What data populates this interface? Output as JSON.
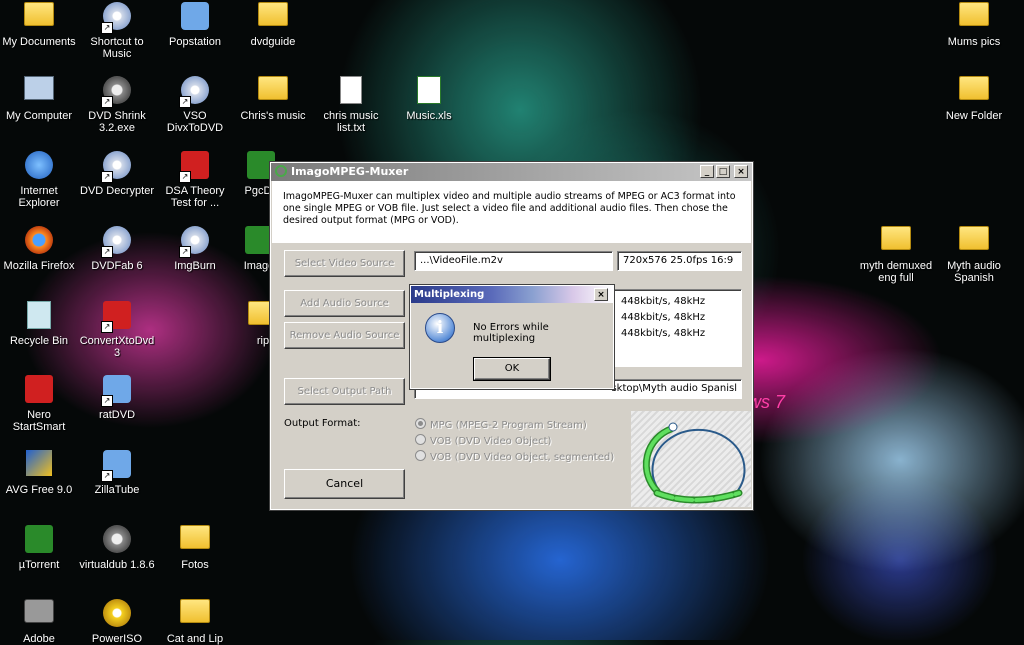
{
  "desktop": {
    "icons": [
      {
        "id": "my-documents",
        "label": "My Documents",
        "glyph": "g-folder",
        "shortcut": false
      },
      {
        "id": "shortcut-music",
        "label": "Shortcut to Music",
        "glyph": "g-disc",
        "shortcut": true
      },
      {
        "id": "popstation",
        "label": "Popstation",
        "glyph": "g-generic",
        "shortcut": false
      },
      {
        "id": "dvdguide",
        "label": "dvdguide",
        "glyph": "g-folder",
        "shortcut": false
      },
      {
        "id": "mums-pics",
        "label": "Mums pics",
        "glyph": "g-folder",
        "shortcut": false
      },
      {
        "id": "my-computer",
        "label": "My Computer",
        "glyph": "g-pc",
        "shortcut": false
      },
      {
        "id": "dvd-shrink",
        "label": "DVD Shrink 3.2.exe",
        "glyph": "g-gear",
        "shortcut": true
      },
      {
        "id": "vso-divx",
        "label": "VSO DivxToDVD",
        "glyph": "g-disc",
        "shortcut": true
      },
      {
        "id": "chris-music",
        "label": "Chris's music",
        "glyph": "g-folder",
        "shortcut": false
      },
      {
        "id": "chris-music-list",
        "label": "chris music list.txt",
        "glyph": "g-doc",
        "shortcut": false
      },
      {
        "id": "music-xls",
        "label": "Music.xls",
        "glyph": "g-xls",
        "shortcut": false
      },
      {
        "id": "new-folder",
        "label": "New Folder",
        "glyph": "g-folder",
        "shortcut": false
      },
      {
        "id": "internet-explorer",
        "label": "Internet Explorer",
        "glyph": "g-ie",
        "shortcut": false
      },
      {
        "id": "dvd-decrypter",
        "label": "DVD Decrypter",
        "glyph": "g-disc",
        "shortcut": true
      },
      {
        "id": "dsa-theory",
        "label": "DSA Theory Test for ...",
        "glyph": "g-red",
        "shortcut": true
      },
      {
        "id": "pgcde",
        "label": "PgcDe",
        "glyph": "g-green",
        "shortcut": false
      },
      {
        "id": "mozilla-firefox",
        "label": "Mozilla Firefox",
        "glyph": "g-fox",
        "shortcut": false
      },
      {
        "id": "dvdfab",
        "label": "DVDFab 6",
        "glyph": "g-disc",
        "shortcut": true
      },
      {
        "id": "imgburn",
        "label": "ImgBurn",
        "glyph": "g-disc",
        "shortcut": true
      },
      {
        "id": "imago",
        "label": "Imago",
        "glyph": "g-green",
        "shortcut": false
      },
      {
        "id": "myth-demuxed",
        "label": "myth demuxed eng full",
        "glyph": "g-folder",
        "shortcut": false
      },
      {
        "id": "myth-audio",
        "label": "Myth audio Spanish",
        "glyph": "g-folder",
        "shortcut": false
      },
      {
        "id": "recycle-bin",
        "label": "Recycle Bin",
        "glyph": "g-bin",
        "shortcut": false
      },
      {
        "id": "convertxtodvd",
        "label": "ConvertXtoDvd 3",
        "glyph": "g-red",
        "shortcut": true
      },
      {
        "id": "rip",
        "label": "rip",
        "glyph": "g-folder",
        "shortcut": false
      },
      {
        "id": "nero",
        "label": "Nero StartSmart",
        "glyph": "g-red",
        "shortcut": false
      },
      {
        "id": "ratdvd",
        "label": "ratDVD",
        "glyph": "g-generic",
        "shortcut": true
      },
      {
        "id": "avg",
        "label": "AVG Free 9.0",
        "glyph": "g-avg",
        "shortcut": false
      },
      {
        "id": "zillatube",
        "label": "ZillaTube",
        "glyph": "g-generic",
        "shortcut": true
      },
      {
        "id": "utorrent",
        "label": "µTorrent",
        "glyph": "g-green",
        "shortcut": false
      },
      {
        "id": "virtualdub",
        "label": "virtualdub 1.8.6",
        "glyph": "g-gear",
        "shortcut": false
      },
      {
        "id": "fotos",
        "label": "Fotos",
        "glyph": "g-folder",
        "shortcut": false
      },
      {
        "id": "adobe",
        "label": "Adobe",
        "glyph": "g-cam",
        "shortcut": false
      },
      {
        "id": "poweriso",
        "label": "PowerISO",
        "glyph": "g-iso",
        "shortcut": false
      },
      {
        "id": "cat-and-lip",
        "label": "Cat and Lip",
        "glyph": "g-folder",
        "shortcut": false
      }
    ],
    "wallpaper_fragment": "ws 7"
  },
  "window": {
    "title": "ImagoMPEG-Muxer",
    "description": "ImagoMPEG-Muxer can multiplex video and multiple audio streams of MPEG or AC3 format into one single MPEG or VOB file. Just select a video file and additional audio files. Then chose the desired output format (MPG or VOD).",
    "select_video_label": "Select Video Source",
    "video_path": "...\\VideoFile.m2v",
    "video_info": "720x576 25.0fps 16:9",
    "add_audio_label": "Add Audio Source",
    "remove_audio_label": "Remove Audio Source",
    "audio_items": [
      "448kbit/s, 48kHz",
      "448kbit/s, 48kHz",
      "448kbit/s, 48kHz"
    ],
    "select_output_label": "Select Output Path",
    "output_path": "sktop\\Myth audio Spanisl",
    "output_format_label": "Output Format:",
    "formats": [
      {
        "label": "MPG (MPEG-2 Program Stream)",
        "selected": true
      },
      {
        "label": "VOB (DVD Video Object)",
        "selected": false
      },
      {
        "label": "VOB (DVD Video Object, segmented)",
        "selected": false
      }
    ],
    "cancel_label": "Cancel"
  },
  "dialog": {
    "title": "Multiplexing",
    "message": "No Errors while multiplexing",
    "ok_label": "OK"
  },
  "colors": {
    "title_gray": "#7a7a7a",
    "face": "#d4d0c8",
    "dialog_title": "#2a3a8a",
    "logo_green": "#3fbf3f"
  }
}
